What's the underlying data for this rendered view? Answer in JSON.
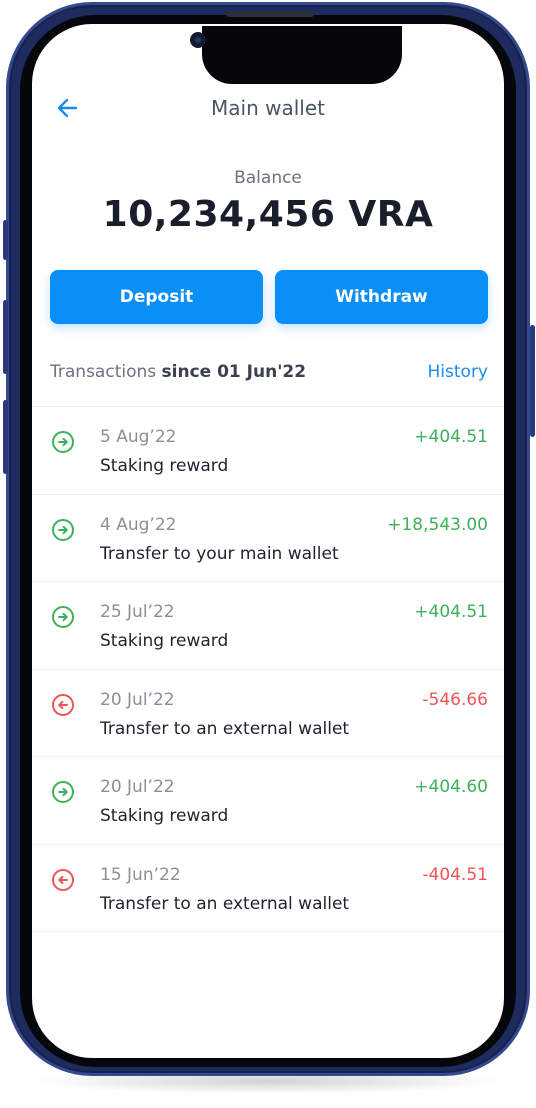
{
  "header": {
    "title": "Main wallet"
  },
  "balance": {
    "label": "Balance",
    "value": "10,234,456 VRA"
  },
  "actions": {
    "deposit": "Deposit",
    "withdraw": "Withdraw"
  },
  "transactions": {
    "label": "Transactions",
    "since": "since 01 Jun'22",
    "history_link": "History",
    "items": [
      {
        "date": "5 Aug’22",
        "description": "Staking reward",
        "amount": "+404.51",
        "direction": "in"
      },
      {
        "date": "4 Aug’22",
        "description": "Transfer to your main wallet",
        "amount": "+18,543.00",
        "direction": "in"
      },
      {
        "date": "25 Jul’22",
        "description": "Staking reward",
        "amount": "+404.51",
        "direction": "in"
      },
      {
        "date": "20 Jul’22",
        "description": "Transfer to an external wallet",
        "amount": "-546.66",
        "direction": "out"
      },
      {
        "date": "20 Jul’22",
        "description": "Staking reward",
        "amount": "+404.60",
        "direction": "in"
      },
      {
        "date": "15 Jun’22",
        "description": "Transfer to an external wallet",
        "amount": "-404.51",
        "direction": "out"
      }
    ]
  },
  "colors": {
    "accent": "#0a8ef7",
    "positive": "#3bb25a",
    "negative": "#f05454",
    "phone_frame": "#1d2b5e"
  },
  "icons": {
    "back": "arrow-left-icon",
    "incoming": "arrow-right-circle-icon",
    "outgoing": "arrow-left-circle-icon"
  }
}
